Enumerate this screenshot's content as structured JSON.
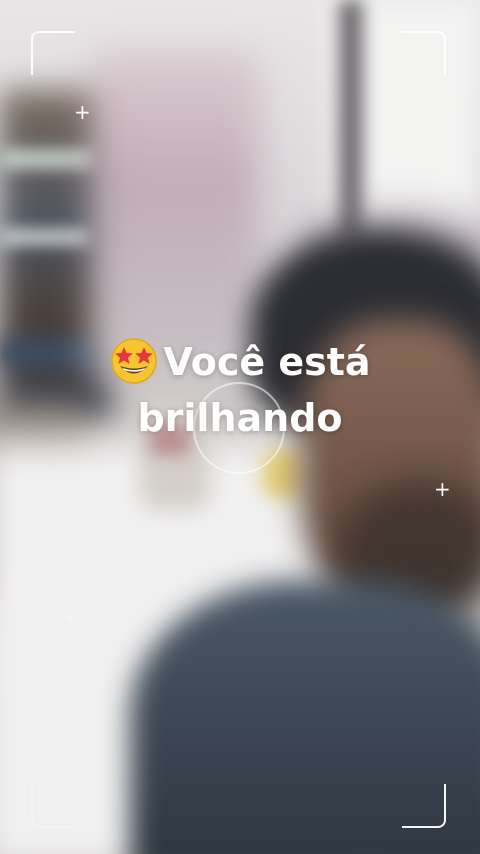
{
  "caption": {
    "emoji_icon": "star-struck-emoji-icon",
    "line1": "Você está",
    "line2": "brilhando"
  },
  "camera_frame": {
    "plus_glyph": "+"
  },
  "colors": {
    "text": "#ffffff",
    "emoji_face": "#f6c532",
    "emoji_stars": "#e8343b"
  }
}
